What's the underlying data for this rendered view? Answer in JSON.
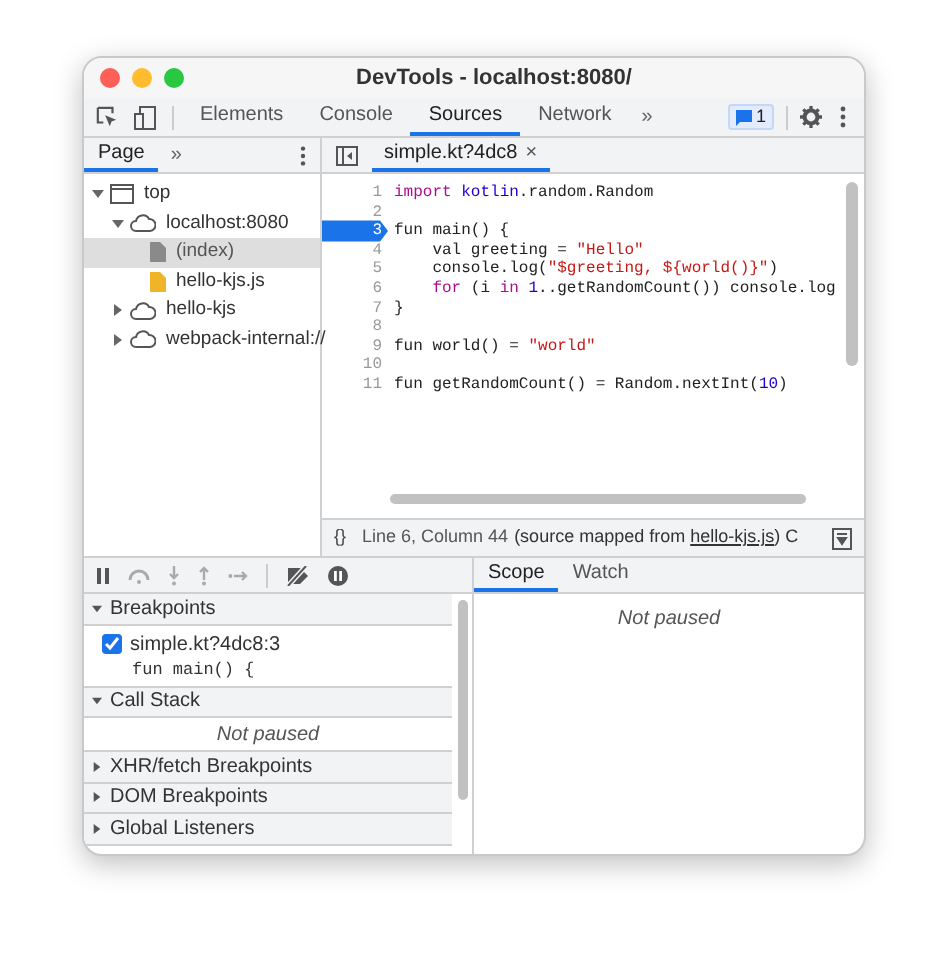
{
  "window": {
    "title": "DevTools - localhost:8080/"
  },
  "tabs": [
    {
      "label": "Elements",
      "selected": false
    },
    {
      "label": "Console",
      "selected": false
    },
    {
      "label": "Sources",
      "selected": true
    },
    {
      "label": "Network",
      "selected": false
    }
  ],
  "more_tabs": "»",
  "issues_badge": "1",
  "navigator": {
    "tabs": [
      {
        "label": "Page",
        "selected": true
      }
    ],
    "more": "»",
    "tree": [
      {
        "label": "top",
        "kind": "frame",
        "expanded": true,
        "selected": false,
        "children": [
          {
            "label": "localhost:8080",
            "kind": "origin",
            "expanded": true,
            "selected": false,
            "children": [
              {
                "label": "(index)",
                "kind": "document",
                "selected": true
              },
              {
                "label": "hello-kjs.js",
                "kind": "script",
                "selected": false
              }
            ]
          },
          {
            "label": "hello-kjs",
            "kind": "origin",
            "expanded": false,
            "selected": false
          },
          {
            "label": "webpack-internal://",
            "kind": "origin",
            "expanded": false,
            "selected": false
          }
        ]
      }
    ]
  },
  "editor": {
    "tabs": [
      {
        "label": "simple.kt?4dc8",
        "selected": true,
        "close": "×"
      }
    ],
    "lines": [
      {
        "number": "1",
        "breakpoint": false,
        "tokens": [
          {
            "text": "import",
            "kind": "keyword"
          },
          {
            "text": " kotlin",
            "kind": "name"
          },
          {
            "text": ".random.Random",
            "kind": "plain"
          }
        ]
      },
      {
        "number": "2",
        "breakpoint": false
      },
      {
        "number": "3",
        "breakpoint": true,
        "tokens": [
          {
            "text": "fun main() {",
            "kind": "plain"
          }
        ]
      },
      {
        "number": "4",
        "breakpoint": false,
        "tokens": [
          {
            "text": "    val greeting = ",
            "kind": "plain"
          },
          {
            "text": "\"Hello\"",
            "kind": "string"
          }
        ]
      },
      {
        "number": "5",
        "breakpoint": false,
        "tokens": [
          {
            "text": "    console.log(",
            "kind": "plain"
          },
          {
            "text": "\"$greeting, ${world()}\"",
            "kind": "string"
          },
          {
            "text": ")",
            "kind": "plain"
          }
        ]
      },
      {
        "number": "6",
        "breakpoint": false,
        "tokens": [
          {
            "text": "    for",
            "kind": "keyword"
          },
          {
            "text": " (i ",
            "kind": "plain"
          },
          {
            "text": "in",
            "kind": "keyword"
          },
          {
            "text": " 1",
            "kind": "number"
          },
          {
            "text": "..getRandomCount()) console.log",
            "kind": "plain"
          }
        ]
      },
      {
        "number": "7",
        "breakpoint": false,
        "tokens": [
          {
            "text": "}",
            "kind": "plain"
          }
        ]
      },
      {
        "number": "8",
        "breakpoint": false
      },
      {
        "number": "9",
        "breakpoint": false,
        "tokens": [
          {
            "text": "fun world() = ",
            "kind": "plain"
          },
          {
            "text": "\"world\"",
            "kind": "string"
          }
        ]
      },
      {
        "number": "10",
        "breakpoint": false
      },
      {
        "number": "11",
        "breakpoint": false,
        "tokens": [
          {
            "text": "fun getRandomCount() = Random.nextInt(",
            "kind": "plain"
          },
          {
            "text": "10",
            "kind": "number"
          },
          {
            "text": ")",
            "kind": "plain"
          }
        ]
      }
    ]
  },
  "status_bar": {
    "format_button": "{}",
    "position": "Line 6, Column 44",
    "source_prefix": "(source mapped from ",
    "source_link": "hello-kjs.js",
    "source_suffix": ") C"
  },
  "sidebar": {
    "sections": [
      {
        "title": "Breakpoints",
        "expanded": true,
        "kind": "breakpoints",
        "items": [
          {
            "location": "simple.kt?4dc8:3",
            "code": "fun main() {",
            "checked": true
          }
        ]
      },
      {
        "title": "Call Stack",
        "expanded": true,
        "kind": "message",
        "message": "Not paused"
      },
      {
        "title": "XHR/fetch Breakpoints",
        "expanded": false
      },
      {
        "title": "DOM Breakpoints",
        "expanded": false
      },
      {
        "title": "Global Listeners",
        "expanded": false
      }
    ]
  },
  "scope_panel": {
    "tabs": [
      {
        "label": "Scope",
        "selected": true
      },
      {
        "label": "Watch",
        "selected": false
      }
    ],
    "message": "Not paused"
  }
}
